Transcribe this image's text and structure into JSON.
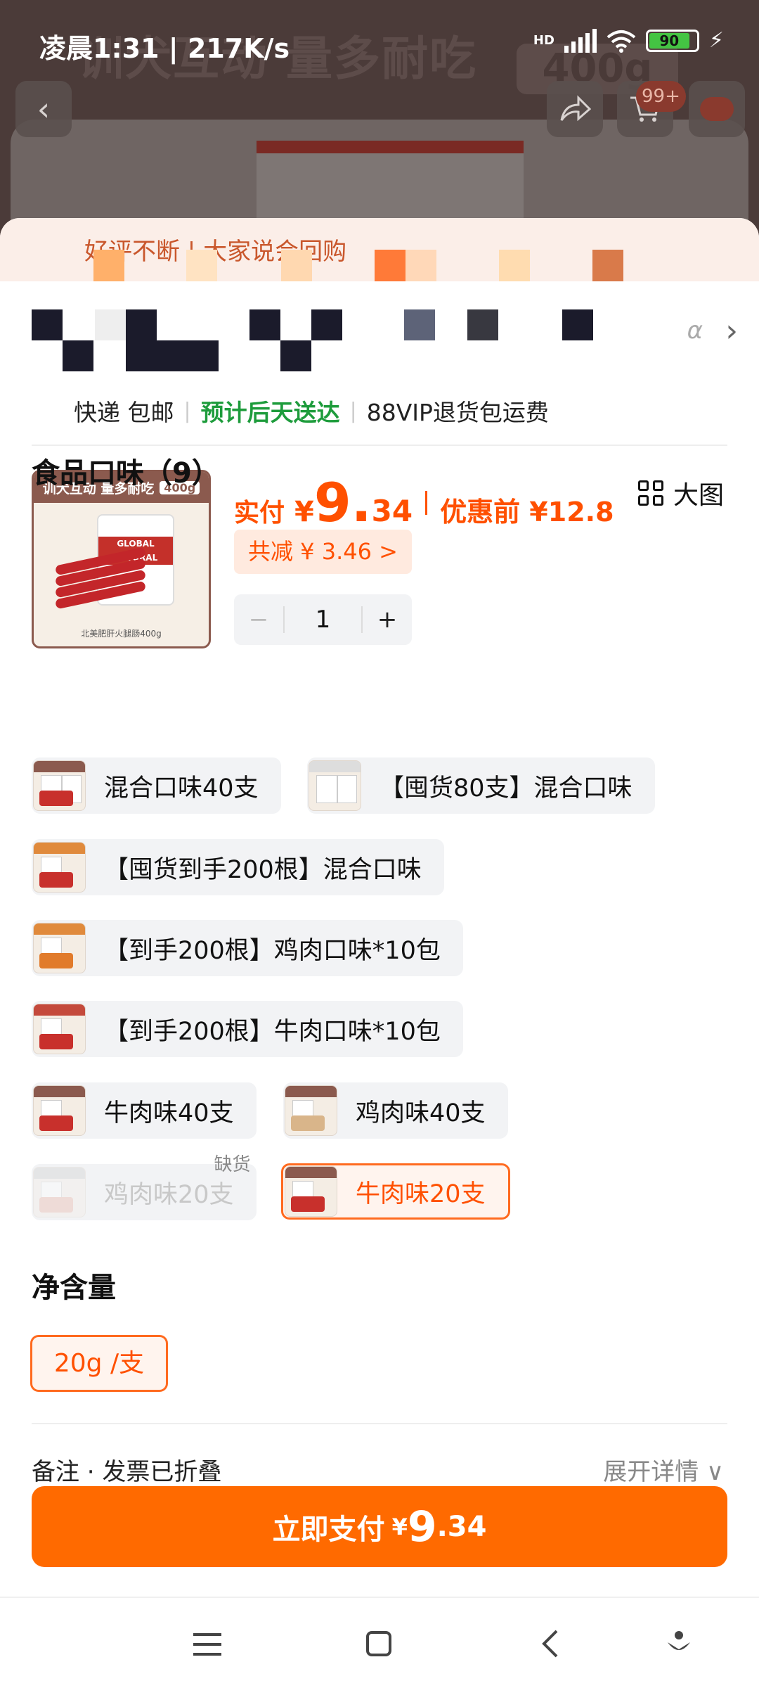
{
  "status_bar": {
    "time": "凌晨1:31",
    "speed": "217K/s",
    "network_label": "HD",
    "battery": "90"
  },
  "background": {
    "banner": "训犬互动 量多耐吃",
    "banner_tag": "400g",
    "cart_badge": "99+"
  },
  "review_strip": {
    "text": "好评不断 | 大家说会回购"
  },
  "shipping": {
    "method": "快递 包邮",
    "eta": "预计后天送达",
    "vip": "88VIP退货包运费"
  },
  "product": {
    "thumb_banner": "训犬互动 量多耐吃",
    "thumb_tag": "400g",
    "thumb_brand": "GLOBAL NATURAL",
    "thumb_caption": "北美肥肝火腿肠400g",
    "pay_label": "实付",
    "currency": "¥",
    "price_int": "9.",
    "price_dec": "34",
    "pre_discount": "优惠前 ¥12.8",
    "discount_total": "共减 ¥ 3.46 >",
    "quantity": "1",
    "minus": "−",
    "plus": "+"
  },
  "flavor_section": {
    "title": "食品口味（9）",
    "big_view": "大图",
    "options": [
      {
        "label": "混合口味40支"
      },
      {
        "label": "【囤货80支】混合口味"
      },
      {
        "label": "【囤货到手200根】混合口味"
      },
      {
        "label": "【到手200根】鸡肉口味*10包"
      },
      {
        "label": "【到手200根】牛肉口味*10包"
      },
      {
        "label": "牛肉味40支"
      },
      {
        "label": "鸡肉味40支"
      },
      {
        "label": "鸡肉味20支",
        "status": "缺货"
      },
      {
        "label": "牛肉味20支"
      }
    ]
  },
  "net_section": {
    "title": "净含量",
    "option": "20g /支"
  },
  "remark": {
    "label": "备注 · 发票已折叠",
    "expand": "展开详情 ∨"
  },
  "pay_button": {
    "label": "立即支付",
    "currency": "¥",
    "price_int": "9",
    "price_dec": ".34"
  },
  "colors": {
    "accent": "#ff5000",
    "button": "#ff6a00",
    "green": "#1e9c3c"
  }
}
